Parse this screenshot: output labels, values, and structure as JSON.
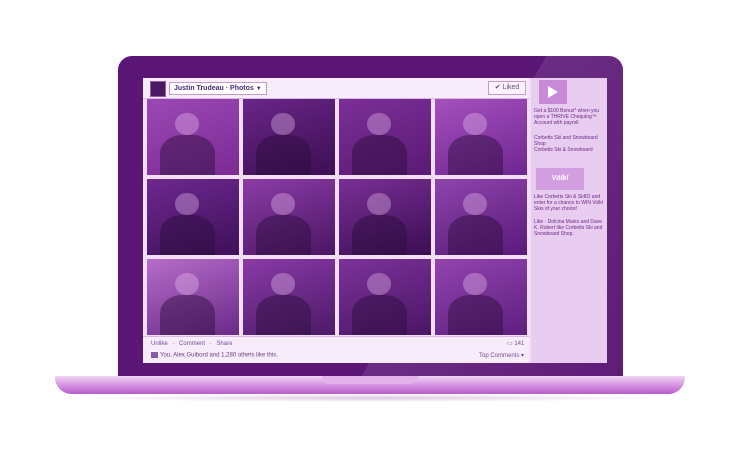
{
  "header": {
    "page_name": "Justin Trudeau",
    "separator": "·",
    "section": "Photos",
    "dropdown_icon": "chevron-down-icon",
    "liked_label": "Liked"
  },
  "photos": [
    {
      "bg": "#9c48b4",
      "accent": "#7a2b92"
    },
    {
      "bg": "#6a2588",
      "accent": "#3c0f52"
    },
    {
      "bg": "#7c2f98",
      "accent": "#5a1a72"
    },
    {
      "bg": "#a550be",
      "accent": "#6e2690"
    },
    {
      "bg": "#6e2890",
      "accent": "#3e1058"
    },
    {
      "bg": "#8c3ca8",
      "accent": "#4a1662"
    },
    {
      "bg": "#7a2f96",
      "accent": "#3a0e52"
    },
    {
      "bg": "#8e44ac",
      "accent": "#5a1a78"
    },
    {
      "bg": "#b66cca",
      "accent": "#6a2a86"
    },
    {
      "bg": "#8a3aa8",
      "accent": "#4c1a66"
    },
    {
      "bg": "#7c329a",
      "accent": "#4a1664"
    },
    {
      "bg": "#9244b0",
      "accent": "#5e1f7c"
    }
  ],
  "footer": {
    "unlike": "Unlike",
    "comment": "Comment",
    "share": "Share",
    "dot": "·",
    "comment_count": "141",
    "likes_text": "You, Alex Guibord and 1,280 others like this.",
    "top_comments": "Top Comments ▾"
  },
  "sidebar": {
    "ad1_text": "Get a $100 Bonus* when you open a THRIVE Chequing™ Account with payroll",
    "ad2_title": "Corbetts Ski and Snowboard Shop",
    "ad2_sub": "Corbetts Ski & Snowboard",
    "logo_text": "Völkl",
    "ad3_text": "Like Corbetts Ski & Sk8O and enter for a chance to WIN Volkl Skis of your choice!",
    "ad3_like": "Like · Dolcina Marks and Dave K. Robert like Corbetts Ski and Snowboard Shop."
  },
  "colors": {
    "lid": "#5a1575",
    "screen_bg": "#f2dff6",
    "sidebar_bg": "#e9cdf0",
    "link": "#4a2a7a"
  }
}
